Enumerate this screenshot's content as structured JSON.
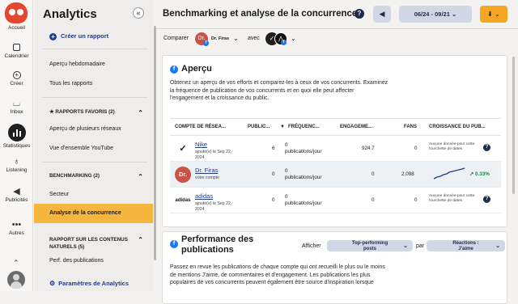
{
  "rail": {
    "items": [
      {
        "label": "Accueil",
        "icon": "hootsuite-owl-icon"
      },
      {
        "label": "Calendrier",
        "icon": "calendar-icon"
      },
      {
        "label": "Créer",
        "icon": "plus-circle-icon"
      },
      {
        "label": "Inbox",
        "icon": "inbox-icon"
      },
      {
        "label": "Statistiques",
        "icon": "bar-chart-icon"
      },
      {
        "label": "Listening",
        "icon": "lightbulb-icon"
      },
      {
        "label": "Publicités",
        "icon": "megaphone-icon"
      },
      {
        "label": "Autres",
        "icon": "more-icon"
      }
    ]
  },
  "sidebar": {
    "title": "Analytics",
    "collapse_icon": "«",
    "create_label": "Créer un rapport",
    "item_weekly": "Aperçu hebdomadaire",
    "item_all": "Tous les rapports",
    "head_favorites": "RAPPORTS FAVORIS (2)",
    "item_multi": "Aperçu de plusieurs réseaux",
    "item_youtube": "Vue d'ensemble YouTube",
    "head_bench": "BENCHMARKING (2)",
    "item_sector": "Secteur",
    "item_competition": "Analyse de la concurrence",
    "head_content_1": "RAPPORT SUR LES CONTENUS",
    "head_content_2": "NATURELS (5)",
    "item_perf": "Perf. des publications",
    "settings_label": "Paramètres de Analytics"
  },
  "topbar": {
    "title": "Benchmarking et analyse de la concurrence",
    "help_icon": "?",
    "date_range": "06/24 - 09/21",
    "date_chevron": "⌄"
  },
  "compare": {
    "label": "Comparer",
    "profile_initials": "Dr.",
    "profile_name": "Dr. Firas",
    "with_label": "avec"
  },
  "overview": {
    "title": "Aperçu",
    "desc_lines": [
      "Obtenez un aperçu de vos efforts et comparez-les à ceux de vos concurrents. Examinez",
      "la fréquence de publication de vos concurrents et en quoi elle peut affecter",
      "l'engagement et la croissance du public."
    ],
    "columns": {
      "account": "COMPTE DE RÉSEA...",
      "posts": "PUBLIC...",
      "freq": "FRÉQUENC...",
      "engagement": "ENGAGEME...",
      "fans": "FANS",
      "growth": "CROISSANCE DU PUB..."
    },
    "rows": [
      {
        "name": "Nike",
        "sub1": "ajouté(e) le Sep 22,",
        "sub2": "2024",
        "posts": "6",
        "freq_val": "0",
        "freq_unit1": "publications/jour",
        "engagement": "924.7",
        "fans": "0",
        "na1": "Aucune donnée pour cette",
        "na2": "fourchette de dates",
        "logo": "✓"
      },
      {
        "name": "Dr. Firas",
        "sub1": "votre compte",
        "sub2": "",
        "posts": "0",
        "freq_val": "0",
        "freq_unit1": "publications/jour",
        "engagement": "0",
        "fans": "2,098",
        "growth": "↗ 0.33%",
        "logo": "Dr."
      },
      {
        "name": "adidas",
        "sub1": "ajouté(e) le Sep 22,",
        "sub2": "2024",
        "posts": "0",
        "freq_val": "0",
        "freq_unit1": "publications/jour",
        "engagement": "0",
        "fans": "0",
        "na1": "Aucune donnée pour cette",
        "na2": "fourchette de dates",
        "logo": "adidas"
      }
    ]
  },
  "performance": {
    "title_1": "Performance des",
    "title_2": "publications",
    "show_label": "Afficher",
    "filter1_1": "Top-performing",
    "filter1_2": "posts",
    "by_label": "par",
    "filter2_1": "Réactions :",
    "filter2_2": "J'aime",
    "desc_lines": [
      "Passez en revue les publications de chaque compte qui ont recueilli le plus ou le moins",
      "de mentions J'aime, de commentaires et d'engagement. Les publications les plus",
      "populaires de vos concurrents peuvent également être source d'inspiration lorsque"
    ]
  },
  "colors": {
    "accent": "#f5b63e",
    "brand": "#1f3b8a",
    "export": "#f5a623",
    "positive": "#128a44"
  }
}
